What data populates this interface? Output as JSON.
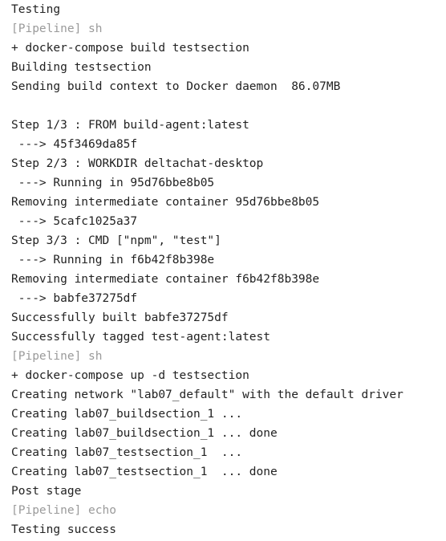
{
  "console": {
    "lines": [
      {
        "text": "Testing",
        "dim": false
      },
      {
        "text": "[Pipeline] sh",
        "dim": true
      },
      {
        "text": "+ docker-compose build testsection",
        "dim": false
      },
      {
        "text": "Building testsection",
        "dim": false
      },
      {
        "text": "Sending build context to Docker daemon  86.07MB",
        "dim": false
      },
      {
        "text": "",
        "dim": false
      },
      {
        "text": "Step 1/3 : FROM build-agent:latest",
        "dim": false
      },
      {
        "text": " ---> 45f3469da85f",
        "dim": false
      },
      {
        "text": "Step 2/3 : WORKDIR deltachat-desktop",
        "dim": false
      },
      {
        "text": " ---> Running in 95d76bbe8b05",
        "dim": false
      },
      {
        "text": "Removing intermediate container 95d76bbe8b05",
        "dim": false
      },
      {
        "text": " ---> 5cafc1025a37",
        "dim": false
      },
      {
        "text": "Step 3/3 : CMD [\"npm\", \"test\"]",
        "dim": false
      },
      {
        "text": " ---> Running in f6b42f8b398e",
        "dim": false
      },
      {
        "text": "Removing intermediate container f6b42f8b398e",
        "dim": false
      },
      {
        "text": " ---> babfe37275df",
        "dim": false
      },
      {
        "text": "Successfully built babfe37275df",
        "dim": false
      },
      {
        "text": "Successfully tagged test-agent:latest",
        "dim": false
      },
      {
        "text": "[Pipeline] sh",
        "dim": true
      },
      {
        "text": "+ docker-compose up -d testsection",
        "dim": false
      },
      {
        "text": "Creating network \"lab07_default\" with the default driver",
        "dim": false
      },
      {
        "text": "Creating lab07_buildsection_1 ...",
        "dim": false
      },
      {
        "text": "Creating lab07_buildsection_1 ... done",
        "dim": false
      },
      {
        "text": "Creating lab07_testsection_1  ...",
        "dim": false
      },
      {
        "text": "Creating lab07_testsection_1  ... done",
        "dim": false
      },
      {
        "text": "Post stage",
        "dim": false
      },
      {
        "text": "[Pipeline] echo",
        "dim": true
      },
      {
        "text": "Testing success",
        "dim": false
      }
    ]
  },
  "colors": {
    "text": "#222222",
    "dim": "#9a9a9a",
    "background": "#ffffff"
  }
}
